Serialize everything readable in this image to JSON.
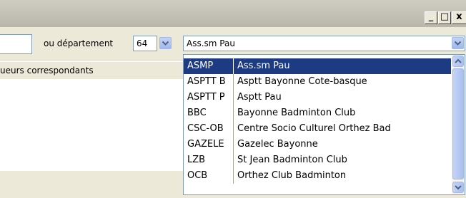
{
  "window": {
    "minimize_label": "_",
    "maximize_label": "□",
    "close_label": "x"
  },
  "filters": {
    "departement_label": "ou département",
    "departement_value": "64",
    "club_value": "Ass.sm Pau"
  },
  "results_header": "ueurs correspondants",
  "club_list": [
    {
      "code": "ASMP",
      "name": "Ass.sm Pau",
      "selected": true
    },
    {
      "code": "ASPTT B",
      "name": "Asptt Bayonne Cote-basque"
    },
    {
      "code": "ASPTT P",
      "name": "Asptt Pau"
    },
    {
      "code": "BBC",
      "name": "Bayonne Badminton Club"
    },
    {
      "code": "CSC-OB",
      "name": "Centre Socio Culturel Orthez Bad"
    },
    {
      "code": "GAZELE",
      "name": "Gazelec Bayonne"
    },
    {
      "code": "LZB",
      "name": "St Jean Badminton Club"
    },
    {
      "code": "OCB",
      "name": "Orthez Club Badminton"
    }
  ],
  "icons": {
    "dropdown": "chevron-down-icon",
    "scroll_up": "chevron-up-icon",
    "scroll_down": "chevron-down-icon"
  },
  "colors": {
    "selection": "#1c3b83",
    "window_bg": "#ece9d8",
    "title_bar": "#c4c1b7"
  }
}
